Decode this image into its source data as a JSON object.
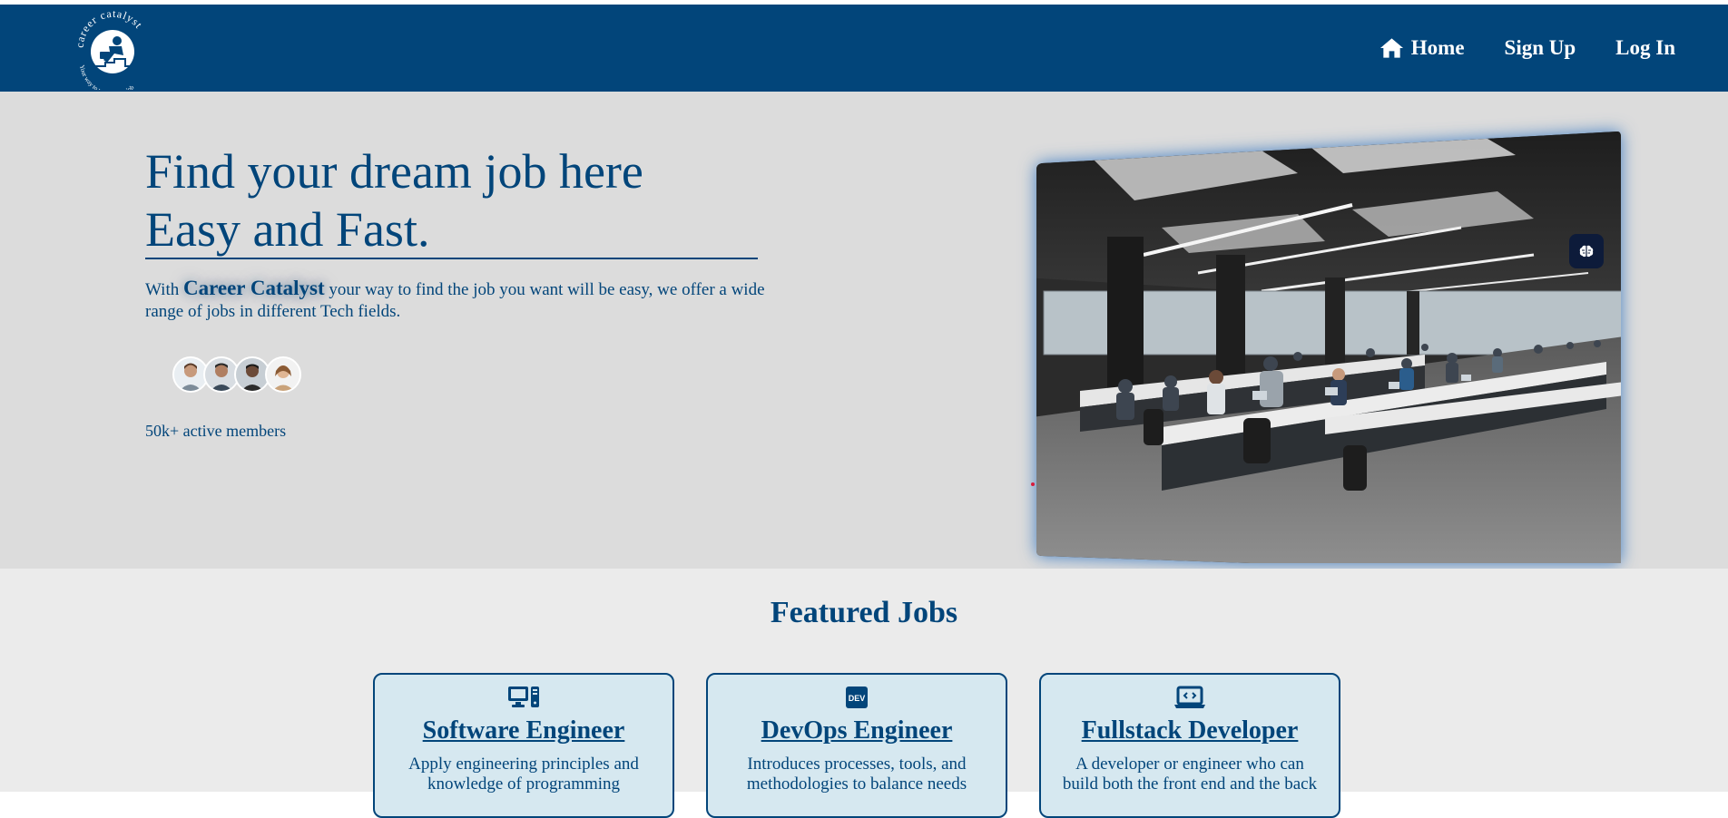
{
  "brand": {
    "name": "career catalyst",
    "tagline": "Your way to your dream job"
  },
  "nav": {
    "home": "Home",
    "signup": "Sign Up",
    "login": "Log In"
  },
  "hero": {
    "title_line1": "Find your dream job here",
    "title_line2": "Easy and Fast.",
    "desc_prefix": "With",
    "desc_brand": "Career Catalyst",
    "desc_suffix": "your way to find the job you want will be easy, we offer a wide range of jobs in different Tech fields.",
    "members": "50k+ active members"
  },
  "featured": {
    "title": "Featured Jobs",
    "jobs": [
      {
        "title": "Software Engineer",
        "icon": "computer-icon",
        "desc": "Apply engineering principles and knowledge of programming"
      },
      {
        "title": "DevOps Engineer",
        "icon": "dev-badge-icon",
        "desc": "Introduces processes, tools, and methodologies to balance needs"
      },
      {
        "title": "Fullstack Developer",
        "icon": "laptop-code-icon",
        "desc": "A developer or engineer who can build both the front end and the back"
      }
    ]
  },
  "colors": {
    "primary": "#02457a",
    "hero_bg": "#dcdcdc",
    "section_bg": "#ebebeb",
    "card_bg": "#d6e8f0"
  }
}
